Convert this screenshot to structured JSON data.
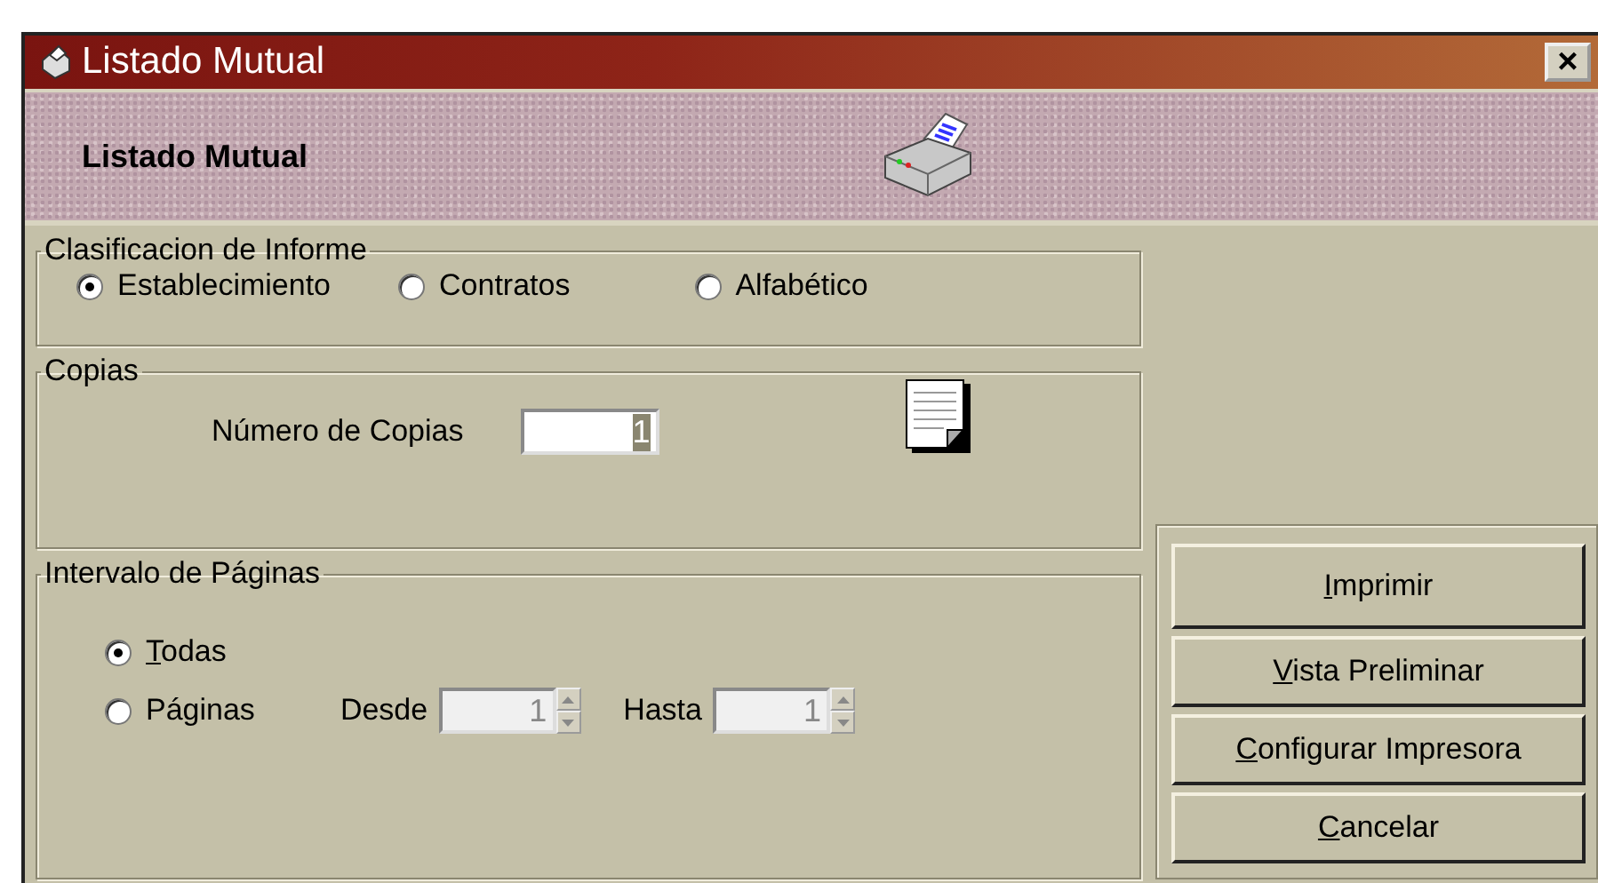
{
  "window": {
    "title": "Listado Mutual",
    "close": "×"
  },
  "header": {
    "title": "Listado Mutual"
  },
  "classification": {
    "legend": "Clasificacion de Informe",
    "options": [
      {
        "label": "Establecimiento",
        "selected": true
      },
      {
        "label": "Contratos",
        "selected": false
      },
      {
        "label": "Alfabético",
        "selected": false
      }
    ]
  },
  "copies": {
    "legend": "Copias",
    "label": "Número de Copias",
    "value": "1",
    "value_selected": true
  },
  "page_range": {
    "legend": "Intervalo de Páginas",
    "options": [
      {
        "label": "Todas",
        "selected": true,
        "underline_first": true
      },
      {
        "label": "Páginas",
        "selected": false,
        "underline_first": false
      }
    ],
    "from": {
      "label": "Desde",
      "value": "1",
      "disabled": true
    },
    "to": {
      "label": "Hasta",
      "value": "1",
      "disabled": true
    }
  },
  "buttons": [
    {
      "label": "Imprimir",
      "underline_first": true
    },
    {
      "label": "Vista Preliminar",
      "underline_first": true
    },
    {
      "label": "Configurar Impresora",
      "underline_first": true
    },
    {
      "label": "Cancelar",
      "underline_first": true
    }
  ]
}
